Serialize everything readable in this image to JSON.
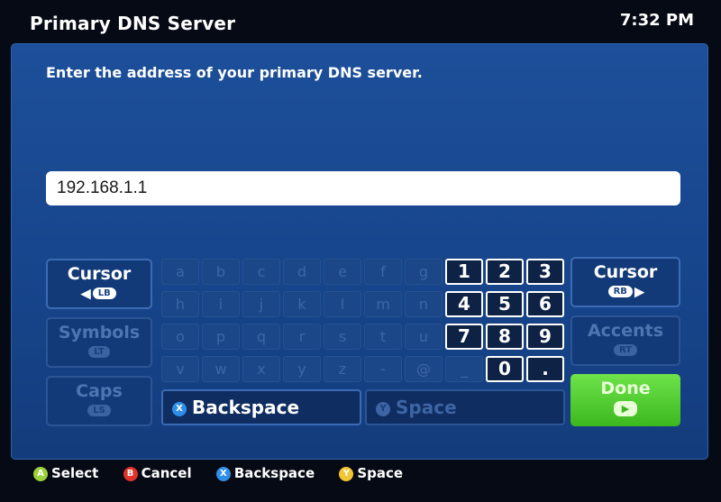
{
  "header": {
    "title": "Primary DNS Server",
    "clock": "7:32 PM"
  },
  "prompt": "Enter the address of your primary DNS server.",
  "input": {
    "value": "192.168.1.1"
  },
  "left_controls": [
    {
      "label": "Cursor",
      "button": "LB",
      "state": "active"
    },
    {
      "label": "Symbols",
      "button": "LT",
      "state": "disabled"
    },
    {
      "label": "Caps",
      "button": "LS",
      "state": "disabled"
    }
  ],
  "right_controls": [
    {
      "label": "Cursor",
      "button": "RB",
      "state": "active"
    },
    {
      "label": "Accents",
      "button": "RT",
      "state": "disabled"
    }
  ],
  "keyboard": {
    "rows": [
      [
        "a",
        "b",
        "c",
        "d",
        "e",
        "f",
        "g",
        "1",
        "2",
        "3"
      ],
      [
        "h",
        "i",
        "j",
        "k",
        "l",
        "m",
        "n",
        "4",
        "5",
        "6"
      ],
      [
        "o",
        "p",
        "q",
        "r",
        "s",
        "t",
        "u",
        "7",
        "8",
        "9"
      ],
      [
        "v",
        "w",
        "x",
        "y",
        "z",
        "-",
        "@",
        "_",
        "0",
        "."
      ]
    ],
    "enabled_keys": [
      "1",
      "2",
      "3",
      "4",
      "5",
      "6",
      "7",
      "8",
      "9",
      "0",
      "."
    ]
  },
  "actions": {
    "backspace": {
      "label": "Backspace",
      "button": "X"
    },
    "space": {
      "label": "Space",
      "button": "Y"
    },
    "done": {
      "label": "Done"
    }
  },
  "footer": [
    {
      "button": "A",
      "label": "Select",
      "color": "#9bd13a"
    },
    {
      "button": "B",
      "label": "Cancel",
      "color": "#e0322b"
    },
    {
      "button": "X",
      "label": "Backspace",
      "color": "#2f8fe8"
    },
    {
      "button": "Y",
      "label": "Space",
      "color": "#f1c534"
    }
  ],
  "colors": {
    "panel": "#1a4a94",
    "done": "#4fcb2c"
  }
}
